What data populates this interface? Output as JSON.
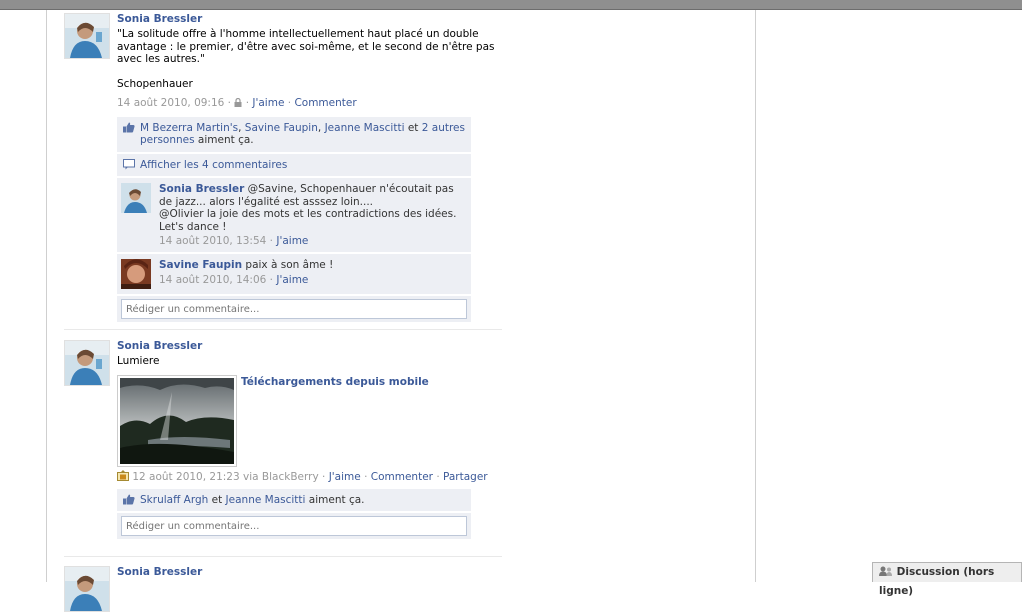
{
  "stories": [
    {
      "actor": "Sonia Bressler",
      "message": "\"La solitude offre à l'homme intellectuellement haut placé un double\navantage : le premier, d'être avec soi-même, et le second de n'être pas\navec les autres.\"\n\nSchopenhauer",
      "timestamp": "14 août 2010, 09:16",
      "like": "J'aime",
      "comment": "Commenter",
      "likers": {
        "names": [
          "M Bezerra Martin's",
          "Savine Faupin",
          "Jeanne Mascitti"
        ],
        "and_word": "et",
        "others": "2 autres personnes",
        "suffix": "aiment ça."
      },
      "view_all": "Afficher les 4 commentaires",
      "comments": [
        {
          "author": "Sonia Bressler",
          "text": "@Savine, Schopenhauer n'écoutait pas de jazz... alors l'égalité est asssez loin....\n@Olivier la joie des mots et les contradictions des idées. Let's dance !",
          "timestamp": "14 août 2010, 13:54",
          "like": "J'aime"
        },
        {
          "author": "Savine Faupin",
          "text": "paix à son âme !",
          "timestamp": "14 août 2010, 14:06",
          "like": "J'aime"
        }
      ],
      "input_placeholder": "Rédiger un commentaire..."
    },
    {
      "actor": "Sonia Bressler",
      "message": "Lumiere",
      "album_link": "Téléchargements depuis mobile",
      "timestamp": "12 août 2010, 21:23",
      "via": "via BlackBerry",
      "like": "J'aime",
      "comment": "Commenter",
      "share": "Partager",
      "likers": {
        "names": [
          "Skrulaff Argh",
          "Jeanne Mascitti"
        ],
        "and_word": "et",
        "suffix": "aiment ça."
      },
      "input_placeholder": "Rédiger un commentaire..."
    },
    {
      "actor": "Sonia Bressler"
    }
  ],
  "chat": {
    "label": "Discussion (hors ligne)"
  },
  "colors": {
    "link": "#3b5998",
    "ufi_background": "#edeff4",
    "muted": "#999999"
  },
  "icons": [
    "lock-icon",
    "thumbs-up-icon",
    "comment-bubble-icon",
    "mobile-upload-icon",
    "chat-user-icon"
  ]
}
